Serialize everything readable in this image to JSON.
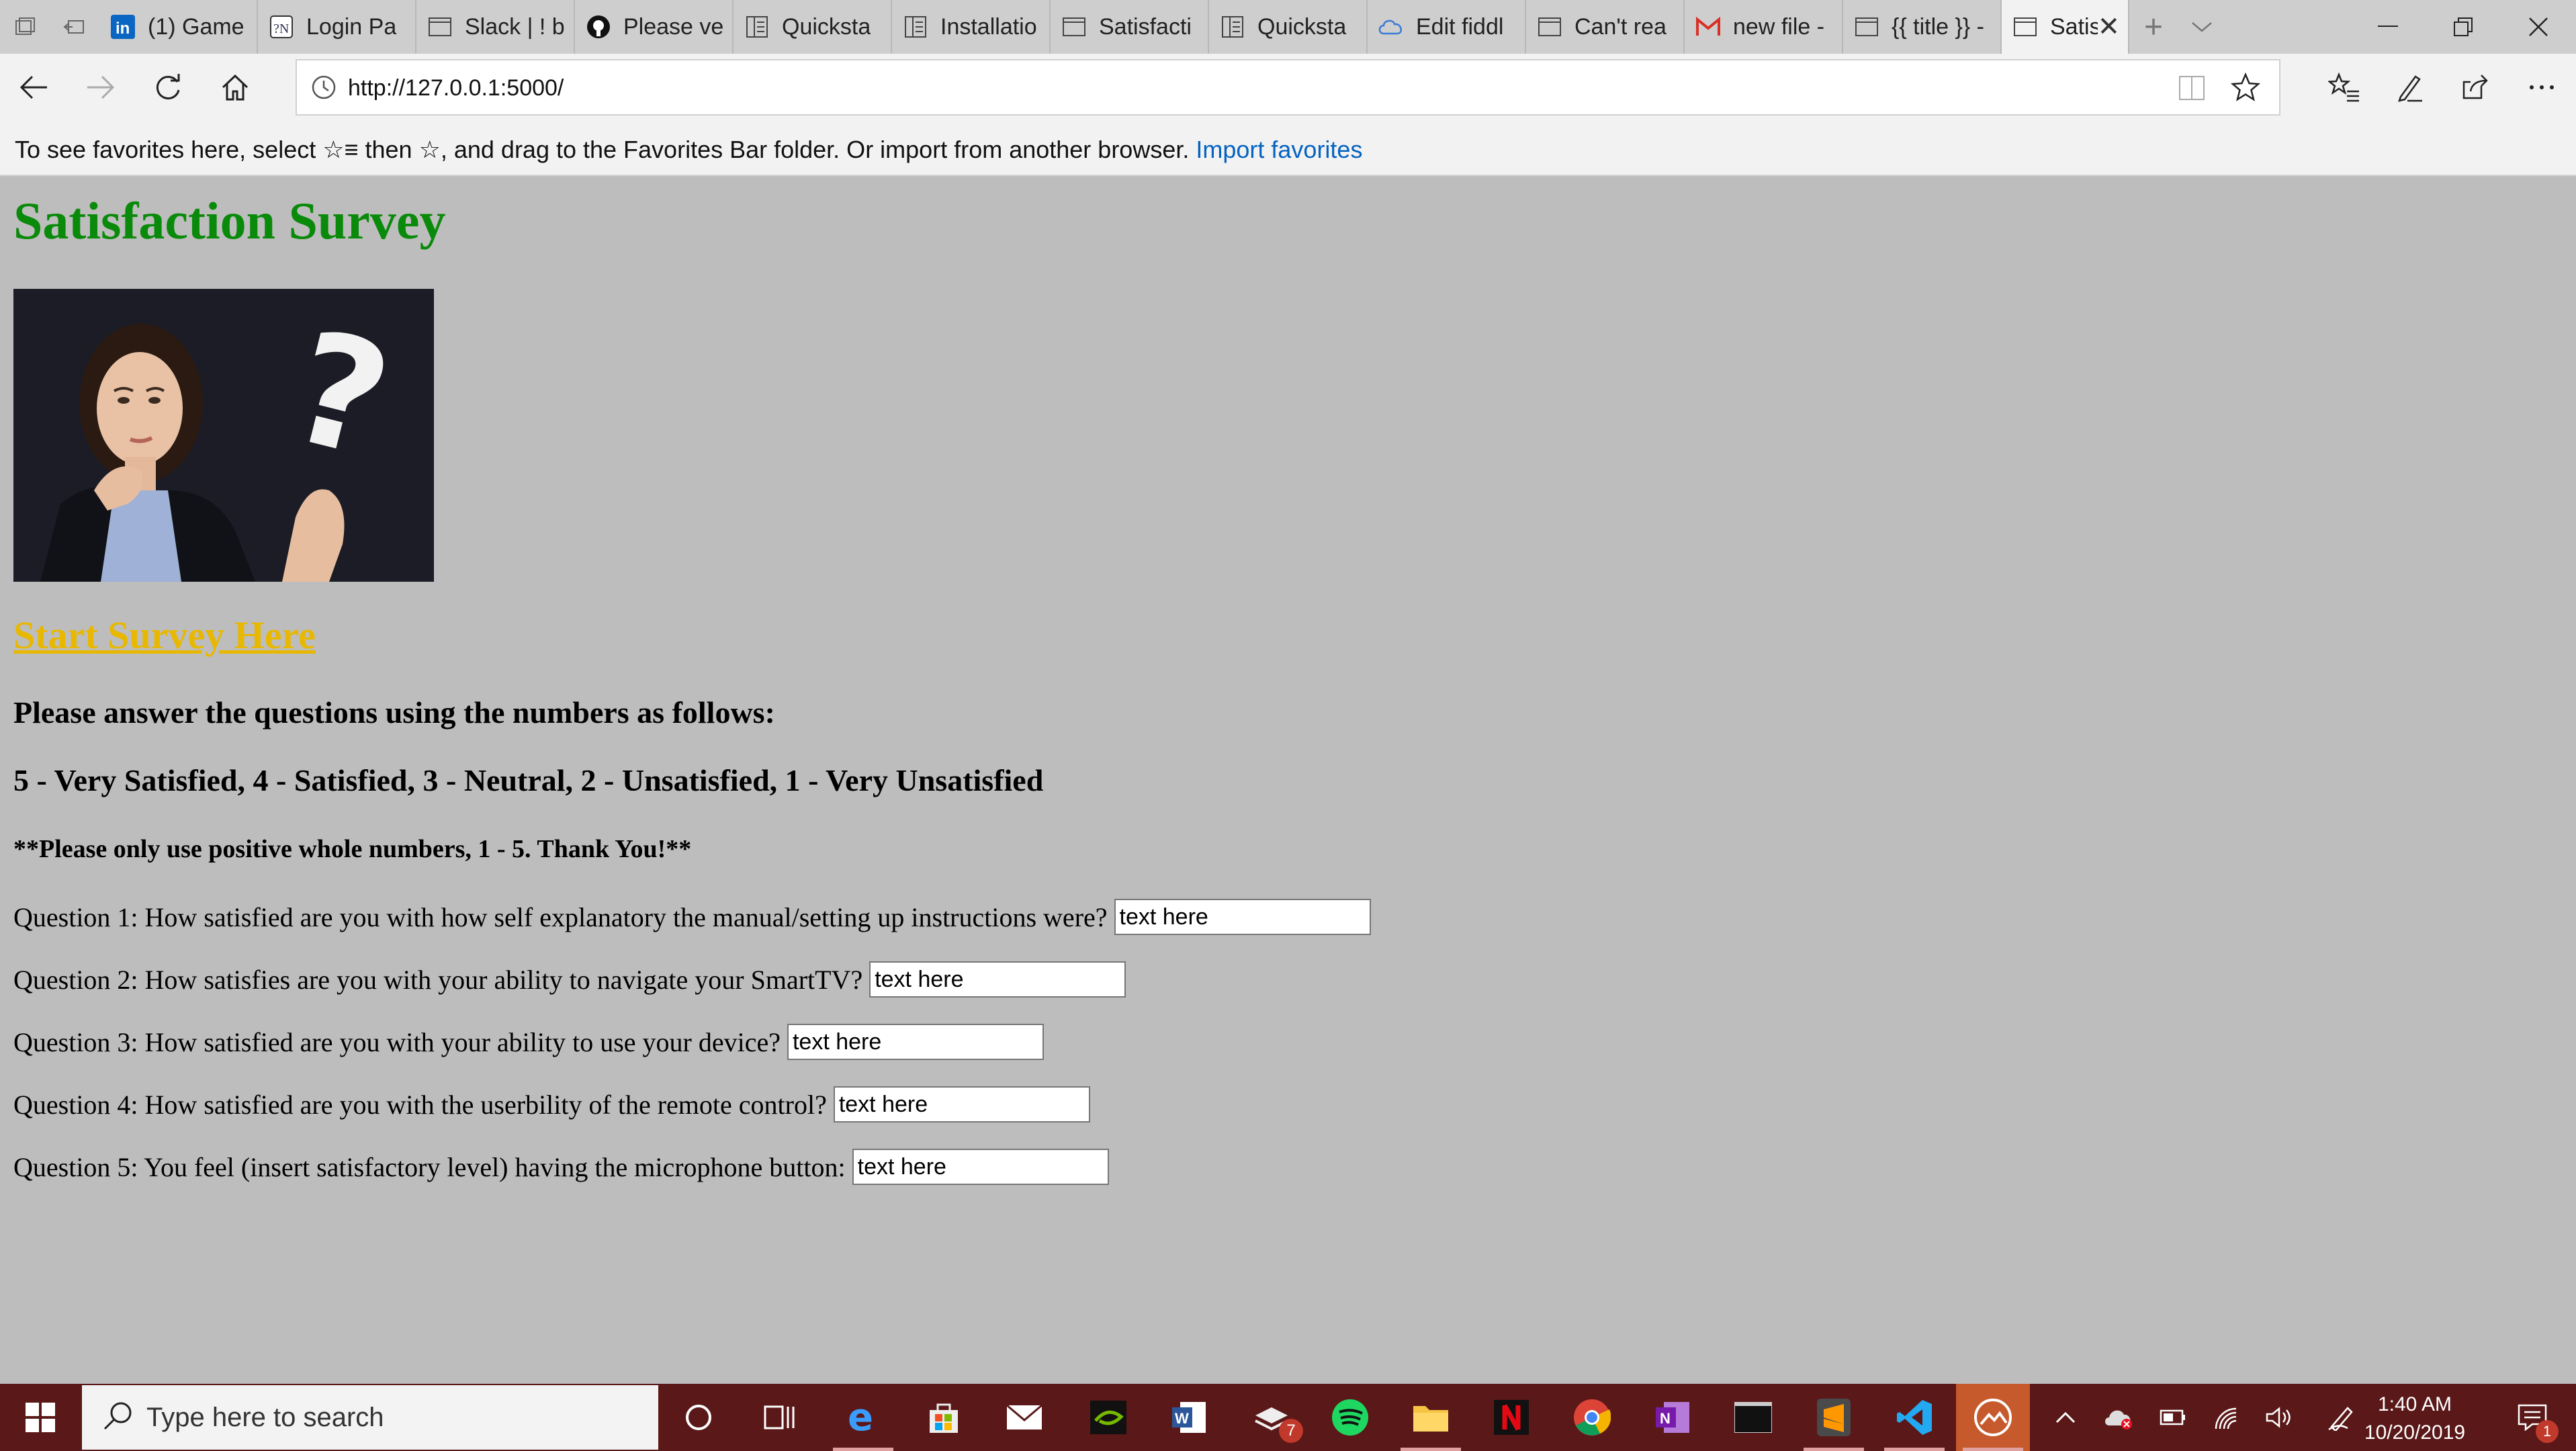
{
  "browser": {
    "tabs": [
      {
        "label": "(1) Game",
        "icon": "linkedin-icon"
      },
      {
        "label": "Login Pa",
        "icon": "login-page-icon"
      },
      {
        "label": "Slack | ! b",
        "icon": "page-icon"
      },
      {
        "label": "Please ve",
        "icon": "github-icon"
      },
      {
        "label": "Quicksta",
        "icon": "docs-icon"
      },
      {
        "label": "Installatio",
        "icon": "docs-icon"
      },
      {
        "label": "Satisfacti",
        "icon": "page-icon"
      },
      {
        "label": "Quicksta",
        "icon": "docs-icon"
      },
      {
        "label": "Edit fiddl",
        "icon": "jsfiddle-icon"
      },
      {
        "label": "Can't rea",
        "icon": "page-icon"
      },
      {
        "label": "new file -",
        "icon": "gmail-icon"
      },
      {
        "label": "{{ title }} -",
        "icon": "page-icon"
      }
    ],
    "active_tab": {
      "label": "Satis",
      "icon": "page-icon"
    },
    "url": "http://127.0.0.1:5000/",
    "favorites_bar": {
      "text": "To see favorites here, select  ☆≡  then ☆, and drag to the Favorites Bar folder. Or import from another browser.",
      "link": "Import favorites"
    }
  },
  "page": {
    "title": "Satisfaction Survey",
    "start_link": "Start Survey Here",
    "instructions_1": "Please answer the questions using the numbers as follows:",
    "instructions_2": "5 - Very Satisfied, 4 - Satisfied, 3 - Neutral, 2 - Unsatisfied, 1 - Very Unsatisfied",
    "instructions_3": "**Please only use positive whole numbers, 1 - 5. Thank You!**",
    "questions": [
      {
        "label": "Question 1: How satisfied are you with how self explanatory the manual/setting up instructions were?",
        "value": "text here"
      },
      {
        "label": "Question 2: How satisfies are you with your ability to navigate your SmartTV?",
        "value": "text here"
      },
      {
        "label": "Question 3: How satisfied are you with your ability to use your device?",
        "value": "text here"
      },
      {
        "label": "Question 4: How satisfied are you with the userbility of the remote control?",
        "value": "text here"
      },
      {
        "label": "Question 5: You feel (insert satisfactory level) having the microphone button:",
        "value": "text here"
      }
    ]
  },
  "taskbar": {
    "search_placeholder": "Type here to search",
    "time": "1:40 AM",
    "date": "10/20/2019",
    "notification_count": "1",
    "app_badge_count": "7"
  },
  "colors": {
    "title": "#0a8a0a",
    "link": "#e8b800",
    "page_bg": "#bdbdbd",
    "taskbar": "#5a1818"
  }
}
